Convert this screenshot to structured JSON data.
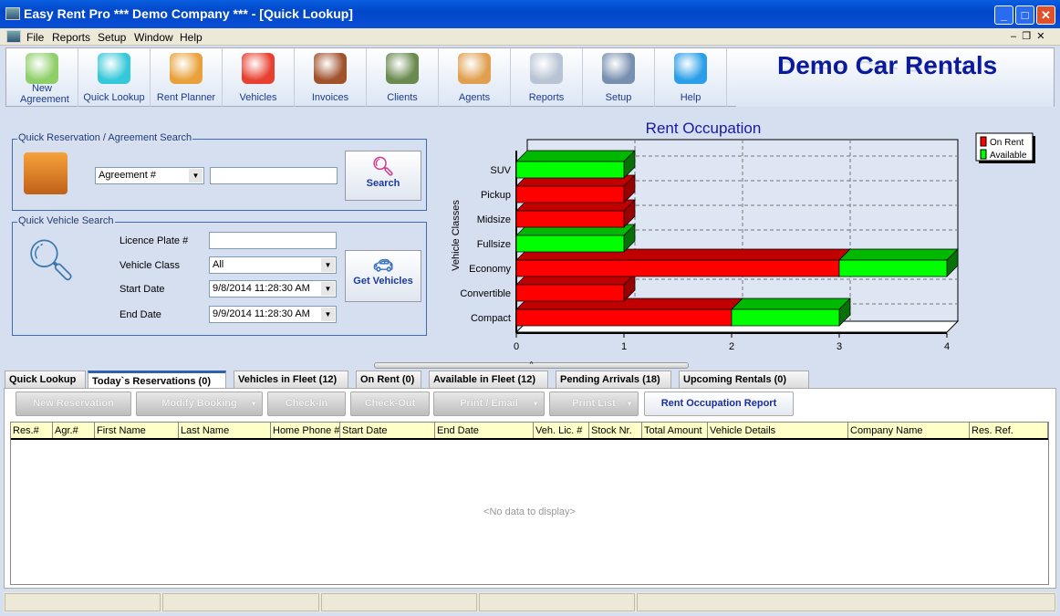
{
  "window": {
    "title": "Easy Rent Pro *** Demo Company *** - [Quick Lookup]"
  },
  "menu": [
    "File",
    "Reports",
    "Setup",
    "Window",
    "Help"
  ],
  "toolbar": [
    {
      "label": "New Agreement",
      "icon": "new-agreement-icon",
      "color": "#8fcf6a"
    },
    {
      "label": "Quick Lookup",
      "icon": "magnifier-car-icon",
      "color": "#35c8d8"
    },
    {
      "label": "Rent Planner",
      "icon": "calendar-clock-icon",
      "color": "#e9a23b"
    },
    {
      "label": "Vehicles",
      "icon": "cars-icon",
      "color": "#e84030"
    },
    {
      "label": "Invoices",
      "icon": "invoice-icon",
      "color": "#a0522d"
    },
    {
      "label": "Clients",
      "icon": "people-icon",
      "color": "#6a8a50"
    },
    {
      "label": "Agents",
      "icon": "agents-icon",
      "color": "#e0a050"
    },
    {
      "label": "Reports",
      "icon": "reports-icon",
      "color": "#b8c4d4"
    },
    {
      "label": "Setup",
      "icon": "gear-icon",
      "color": "#7890b0"
    },
    {
      "label": "Help",
      "icon": "question-icon",
      "color": "#2a9ee8"
    }
  ],
  "brand": "Demo Car Rentals",
  "reservation_search": {
    "title": "Quick Reservation / Agreement Search",
    "type_value": "Agreement #",
    "input_value": "",
    "search_label": "Search"
  },
  "vehicle_search": {
    "title": "Quick  Vehicle Search",
    "licence_label": "Licence Plate #",
    "licence_value": "",
    "class_label": "Vehicle Class",
    "class_value": "All",
    "start_label": "Start Date",
    "start_value": "9/8/2014 11:28:30 AM",
    "end_label": "End Date",
    "end_value": "9/9/2014 11:28:30 AM",
    "button_label": "Get Vehicles"
  },
  "chart_data": {
    "type": "bar",
    "orientation": "horizontal",
    "stacked": true,
    "three_d": true,
    "title": "Rent Occupation",
    "ylabel": "Vehicle Classes",
    "xlabel": "",
    "categories": [
      "Compact",
      "Convertible",
      "Economy",
      "Fullsize",
      "Midsize",
      "Pickup",
      "SUV"
    ],
    "series": [
      {
        "name": "On Rent",
        "color": "#ff0000",
        "values": [
          2,
          1,
          3,
          0,
          1,
          1,
          0
        ]
      },
      {
        "name": "Available",
        "color": "#00ff00",
        "values": [
          1,
          0,
          1,
          1,
          0,
          0,
          1
        ]
      }
    ],
    "xlim": [
      0,
      4
    ],
    "xticks": [
      "0",
      "1",
      "2",
      "3",
      "4"
    ],
    "grid": true,
    "legend": "top-right"
  },
  "tabs": [
    "Quick Lookup",
    "Today`s Reservations (0)",
    "Vehicles in Fleet (12)",
    "On Rent (0)",
    "Available in Fleet (12)",
    "Pending Arrivals (18)",
    "Upcoming Rentals (0)"
  ],
  "active_tab": "Today`s Reservations (0)",
  "actions": [
    "New Reservation",
    "Modify Booking",
    "Check-In",
    "Check-Out",
    "Print / Email",
    "Print List",
    "Rent Occupation Report"
  ],
  "columns": [
    "Res.#",
    "Agr.#",
    "First Name",
    "Last Name",
    "Home Phone #",
    "Start Date",
    "End Date",
    "Veh. Lic. #",
    "Stock Nr.",
    "Total Amount",
    "Vehicle Details",
    "Company Name",
    "Res. Ref."
  ],
  "empty_text": "<No data to display>"
}
